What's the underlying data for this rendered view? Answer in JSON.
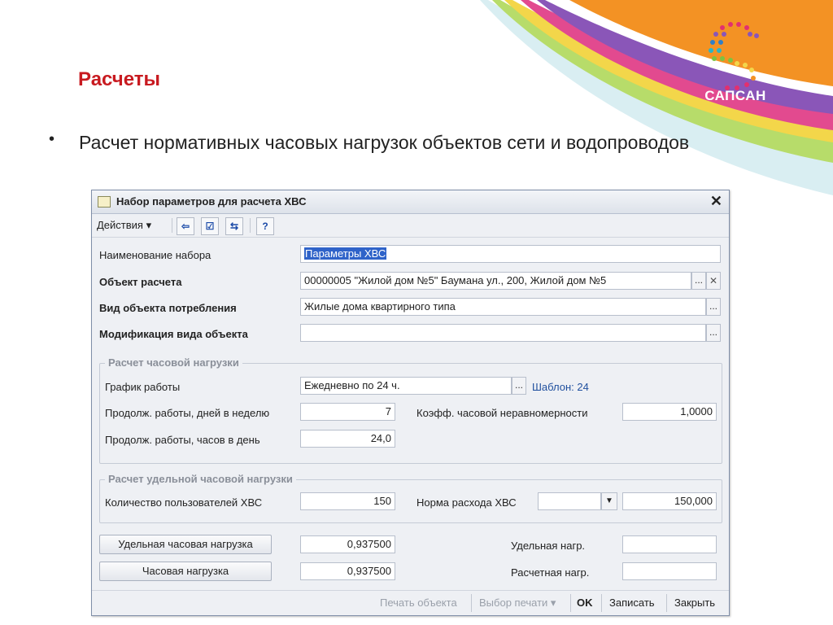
{
  "slide": {
    "title": "Расчеты",
    "bullet": "•",
    "text": "Расчет нормативных часовых нагрузок объектов сети и водопроводов",
    "logo_text": "САПСАН"
  },
  "window": {
    "title": "Набор параметров для расчета ХВС",
    "close": "✕",
    "toolbar": {
      "actions_label": "Действия ▾",
      "buttons": [
        "⇦",
        "☑",
        "⇆",
        "?"
      ]
    },
    "fields": {
      "set_name": {
        "label": "Наименование набора",
        "value": "Параметры ХВС"
      },
      "object": {
        "label": "Объект расчета",
        "value": "00000005 \"Жилой дом №5\" Баумана ул., 200, Жилой дом №5"
      },
      "consumption_type": {
        "label": "Вид объекта потребления",
        "value": "Жилые дома квартирного типа"
      },
      "type_modification": {
        "label": "Модификация вида объекта",
        "value": ""
      }
    },
    "hourly_group": {
      "title": "Расчет часовой нагрузки",
      "schedule_label": "График работы",
      "schedule_value": "Ежедневно по 24 ч.",
      "template_link": "Шаблон: 24",
      "days_label": "Продолж. работы, дней в неделю",
      "days_value": "7",
      "hours_label": "Продолж. работы, часов в день",
      "hours_value": "24,0",
      "coef_label": "Коэфф. часовой неравномерности",
      "coef_value": "1,0000"
    },
    "specific_group": {
      "title": "Расчет удельной часовой нагрузки",
      "users_label": "Количество пользователей ХВС",
      "users_value": "150",
      "norm_label": "Норма расхода ХВС",
      "norm_select": "",
      "norm_value": "150,000"
    },
    "results": {
      "specific_button": "Удельная часовая нагрузка",
      "specific_value": "0,937500",
      "hourly_button": "Часовая нагрузка",
      "hourly_value": "0,937500",
      "spec_load_label": "Удельная нагр.",
      "spec_load_value": "",
      "calc_load_label": "Расчетная нагр.",
      "calc_load_value": ""
    },
    "bottom": {
      "print_object": "Печать объекта",
      "print_select": "Выбор печати ▾",
      "ok": "OK",
      "save": "Записать",
      "close": "Закрыть"
    }
  },
  "colors": {
    "orange": "#f39224",
    "title_red": "#c81a20",
    "selection_blue": "#2f63c9",
    "link_blue": "#1f4f9e"
  }
}
